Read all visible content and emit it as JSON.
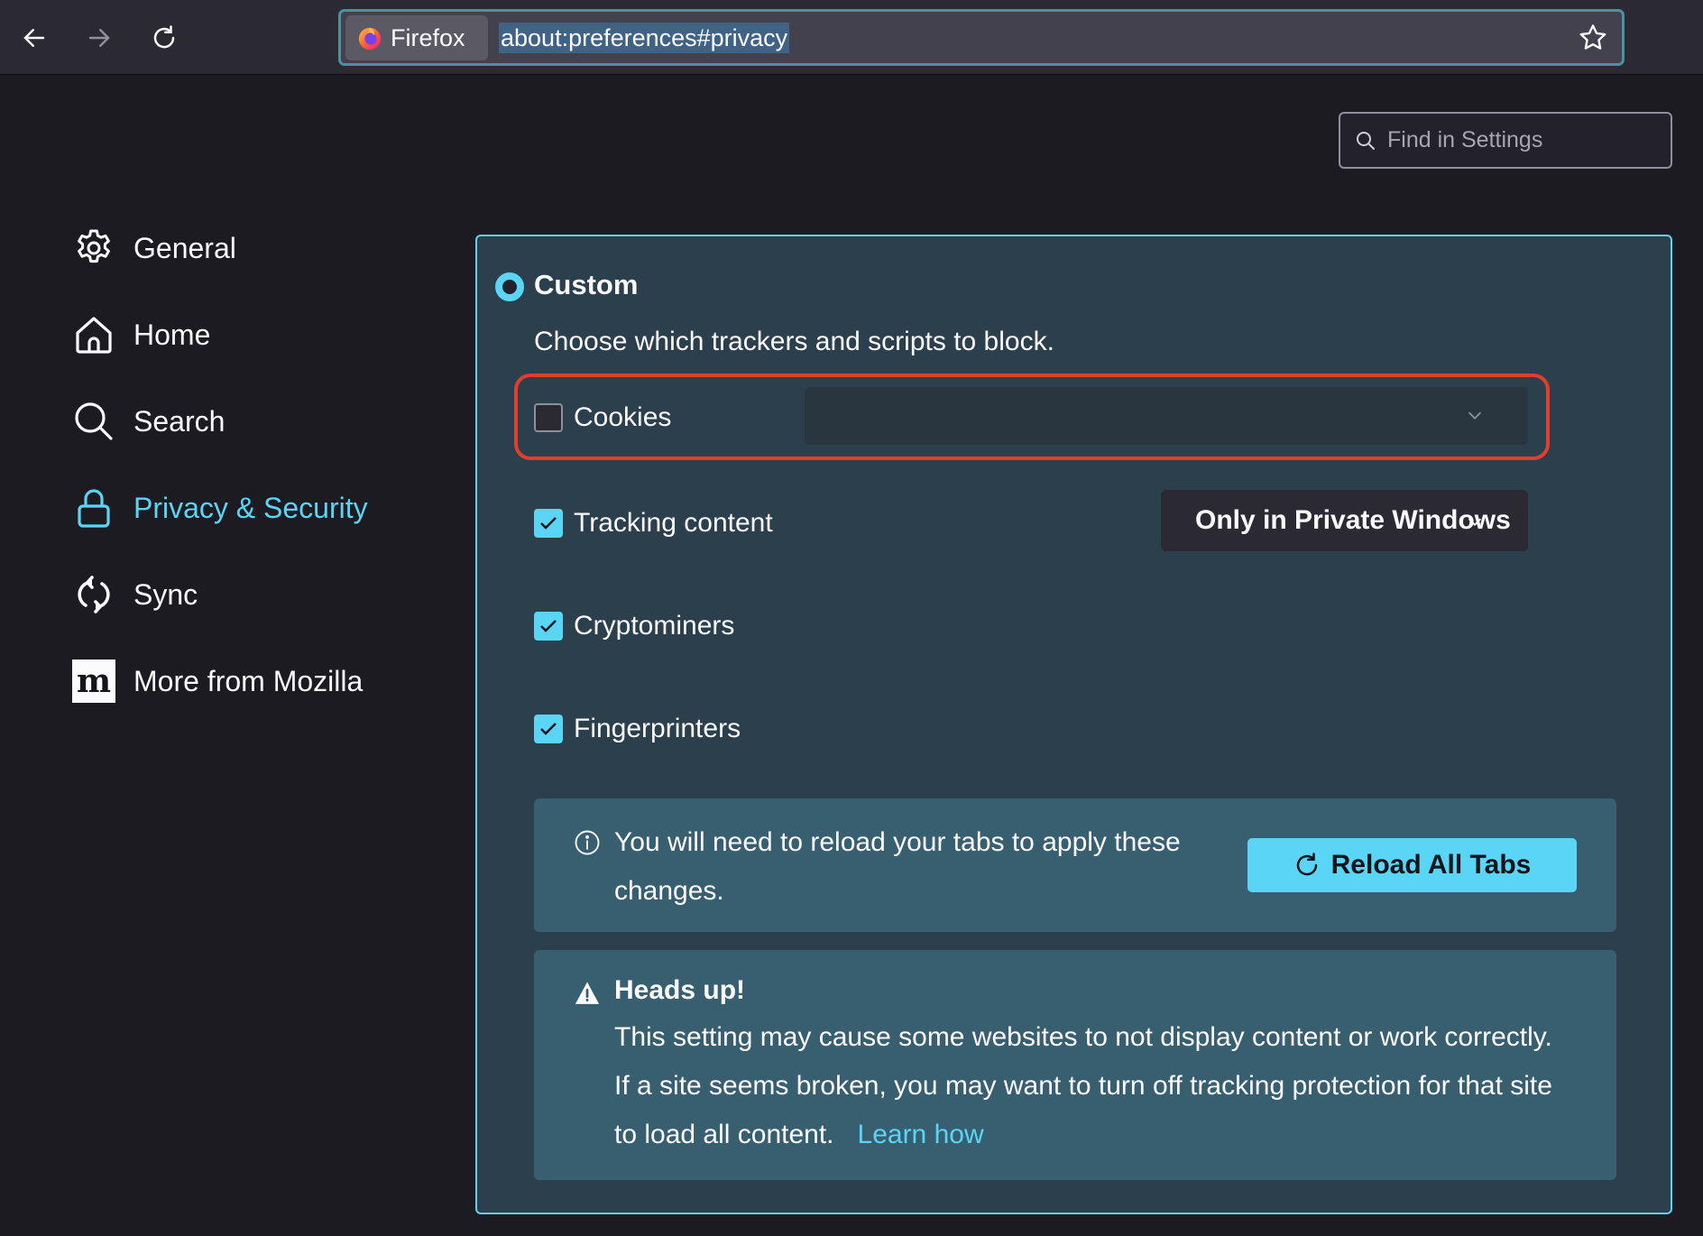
{
  "browser": {
    "identity_label": "Firefox",
    "url": "about:preferences#privacy"
  },
  "search": {
    "placeholder": "Find in Settings",
    "value": ""
  },
  "sidebar": {
    "items": [
      {
        "label": "General",
        "icon": "gear-icon",
        "active": false
      },
      {
        "label": "Home",
        "icon": "home-icon",
        "active": false
      },
      {
        "label": "Search",
        "icon": "search-icon",
        "active": false
      },
      {
        "label": "Privacy & Security",
        "icon": "lock-icon",
        "active": true
      },
      {
        "label": "Sync",
        "icon": "sync-icon",
        "active": false
      },
      {
        "label": "More from Mozilla",
        "icon": "mozilla-icon",
        "active": false
      }
    ]
  },
  "custom": {
    "label": "Custom",
    "selected": true,
    "description": "Choose which trackers and scripts to block.",
    "options": [
      {
        "label": "Cookies",
        "checked": false,
        "select_value": ""
      },
      {
        "label": "Tracking content",
        "checked": true,
        "select_value": "Only in Private Windows"
      },
      {
        "label": "Cryptominers",
        "checked": true
      },
      {
        "label": "Fingerprinters",
        "checked": true
      }
    ]
  },
  "reload_notice": {
    "text": "You will need to reload your tabs to apply these changes.",
    "button_label": "Reload All Tabs"
  },
  "warning": {
    "title": "Heads up!",
    "text": "This setting may cause some websites to not display content or work correctly. If a site seems broken, you may want to turn off tracking protection for that site to load all content.",
    "link_label": "Learn how"
  },
  "colors": {
    "accent": "#5ad5f5",
    "highlight": "#e03f2c",
    "panel_bg": "#2b3f4d",
    "notice_bg": "#385f70"
  }
}
